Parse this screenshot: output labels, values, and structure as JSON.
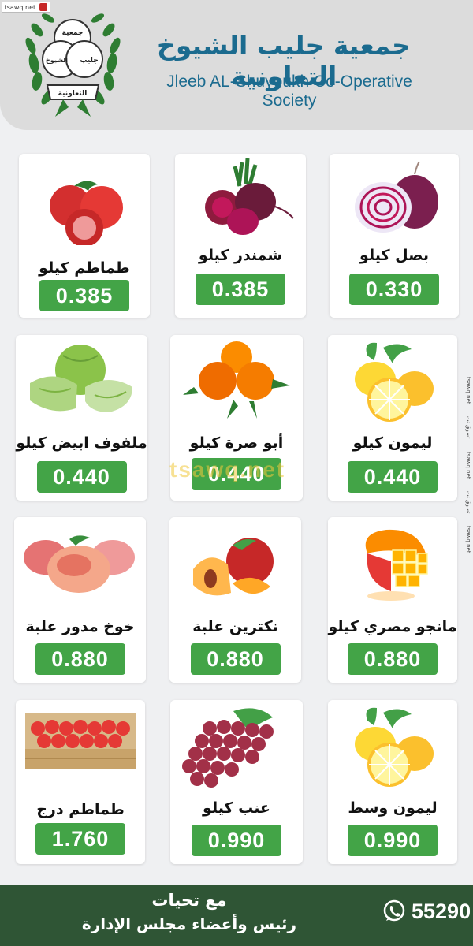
{
  "source_tag": "tsawq.net",
  "logo": {
    "circle_top": "جمعية",
    "circle_left": "الشيوخ",
    "circle_right": "جليب",
    "ribbon": "التعاونية"
  },
  "header": {
    "title_ar": "جمعية جليب الشيوخ التعاونية",
    "title_en": "Jleeb AL-Shuyoukh Co-Operative Society"
  },
  "products": [
    {
      "name": "طماطم كيلو",
      "price": "0.385",
      "icon": "tomato-icon"
    },
    {
      "name": "شمندر كيلو",
      "price": "0.385",
      "icon": "beetroot-icon"
    },
    {
      "name": "بصل كيلو",
      "price": "0.330",
      "icon": "red-onion-icon"
    },
    {
      "name": "ملفوف ابيض كيلو",
      "price": "0.440",
      "icon": "cabbage-icon"
    },
    {
      "name": "أبو صرة كيلو",
      "price": "0.440",
      "icon": "orange-icon"
    },
    {
      "name": "ليمون كيلو",
      "price": "0.440",
      "icon": "lemon-icon"
    },
    {
      "name": "خوخ مدور علبة",
      "price": "0.880",
      "icon": "flat-peach-icon"
    },
    {
      "name": "نكترين علبة",
      "price": "0.880",
      "icon": "nectarine-icon"
    },
    {
      "name": "مانجو مصري كيلو",
      "price": "0.880",
      "icon": "mango-icon"
    },
    {
      "name": "طماطم درج",
      "price": "1.760",
      "icon": "tomato-crate-icon"
    },
    {
      "name": "عنب كيلو",
      "price": "0.990",
      "icon": "grapes-icon"
    },
    {
      "name": "ليمون وسط",
      "price": "0.990",
      "icon": "lemon-icon"
    }
  ],
  "watermark": "tsawq.net",
  "side_tags": [
    "tsawq.net",
    "تسوق نت",
    "tsawq.net",
    "تسوق نت",
    "tsawq.net"
  ],
  "footer": {
    "greeting_line1": "مع تحيات",
    "greeting_line2": "رئيس وأعضاء مجلس الإدارة",
    "phone": "55290",
    "phone_icon": "whatsapp-icon"
  },
  "colors": {
    "price_badge": "#43a447",
    "title": "#1b6b8f",
    "footer": "#2f5535"
  }
}
